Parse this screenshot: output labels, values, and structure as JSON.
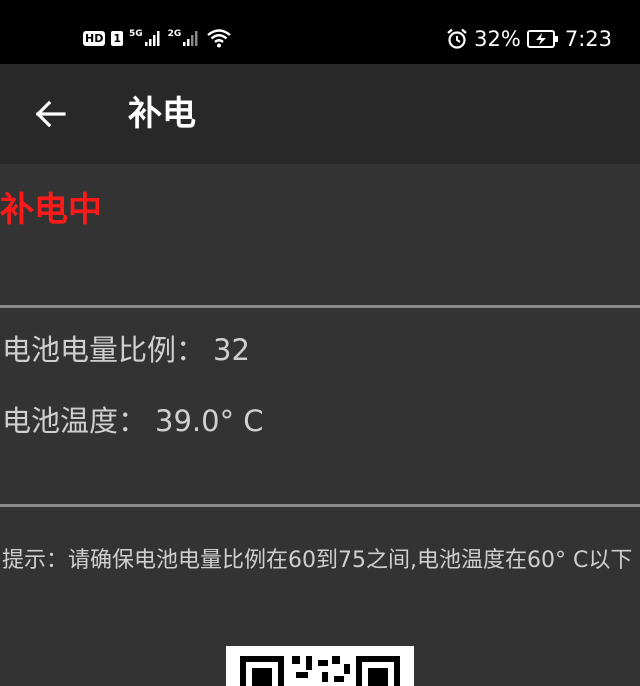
{
  "status_bar": {
    "hd_label": "HD",
    "sim_label": "1",
    "net1_label": "5G",
    "net2_label": "2G",
    "battery_percent": "32%",
    "time": "7:23"
  },
  "app_bar": {
    "title": "补电"
  },
  "charging": {
    "status": "补电中"
  },
  "battery": {
    "level_label": "电池电量比例：",
    "level_value": "32",
    "temp_label": "电池温度：",
    "temp_value": "39.0° C"
  },
  "hint": {
    "text": "提示：请确保电池电量比例在60到75之间,电池温度在60° C以下"
  },
  "colors": {
    "status_red": "#ff1a1a",
    "background": "#333333",
    "app_bar": "#282828"
  },
  "icons": {
    "back": "arrow-left-icon",
    "alarm": "alarm-clock-icon",
    "battery": "battery-charging-icon",
    "wifi": "wifi-icon",
    "signal": "cell-signal-icon"
  }
}
